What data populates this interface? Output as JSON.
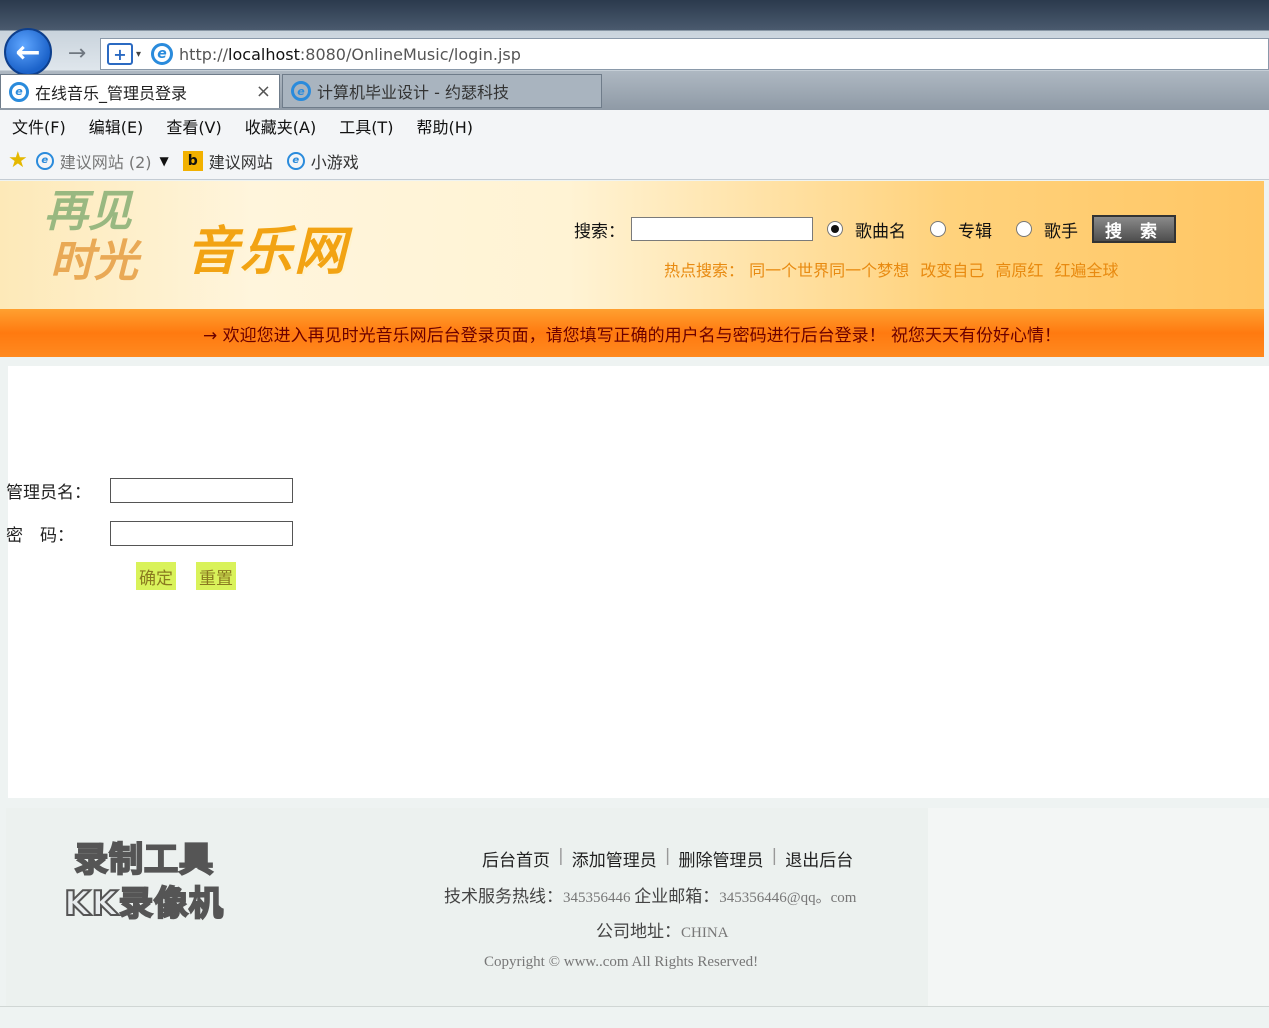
{
  "browser": {
    "address": {
      "url_prefix": "http://",
      "url_host": "localhost",
      "url_rest": ":8080/OnlineMusic/login.jsp"
    },
    "tabs": [
      {
        "label": "在线音乐_管理员登录"
      },
      {
        "label": "计算机毕业设计 - 约瑟科技"
      }
    ],
    "menu": [
      "文件(F)",
      "编辑(E)",
      "查看(V)",
      "收藏夹(A)",
      "工具(T)",
      "帮助(H)"
    ],
    "favorites": [
      {
        "label": "建议网站 (2)"
      },
      {
        "label": "建议网站"
      },
      {
        "label": "小游戏"
      }
    ]
  },
  "header": {
    "logo_script_line1": "再见",
    "logo_script_line2": "时光",
    "logo_text": "音乐网",
    "search_label": "搜索：",
    "search_value": "",
    "radio_options": [
      {
        "label": "歌曲名",
        "checked": true
      },
      {
        "label": "专辑",
        "checked": false
      },
      {
        "label": "歌手",
        "checked": false
      }
    ],
    "search_button": "搜 索",
    "hot_search_label": "热点搜索：",
    "hot_search_items": [
      "同一个世界同一个梦想",
      "改变自己",
      "高原红",
      "红遍全球"
    ]
  },
  "welcome": "→ 欢迎您进入再见时光音乐网后台登录页面，请您填写正确的用户名与密码进行后台登录！  祝您天天有份好心情！",
  "login": {
    "username_label": "管理员名：",
    "username_value": "",
    "password_label": "密　码：",
    "password_value": "",
    "confirm_button": "确定",
    "reset_button": "重置"
  },
  "footer": {
    "watermark_line1": "录制工具",
    "watermark_line2": "KK录像机",
    "links": [
      "后台首页",
      "添加管理员",
      "删除管理员",
      "退出后台"
    ],
    "hotline_label": "技术服务热线：",
    "hotline_value": "345356446",
    "email_label": "企业邮箱：",
    "email_value": "345356446@qq。com",
    "address_label": "公司地址：",
    "address_value": "CHINA",
    "copyright": "Copyright © www..com All Rights Reserved!"
  },
  "colors": {
    "header_orange": "#ffc664",
    "welcome_bar": "#ff7a10",
    "logo_text": "#f2a313",
    "button_yellow": "#d9f25a"
  }
}
